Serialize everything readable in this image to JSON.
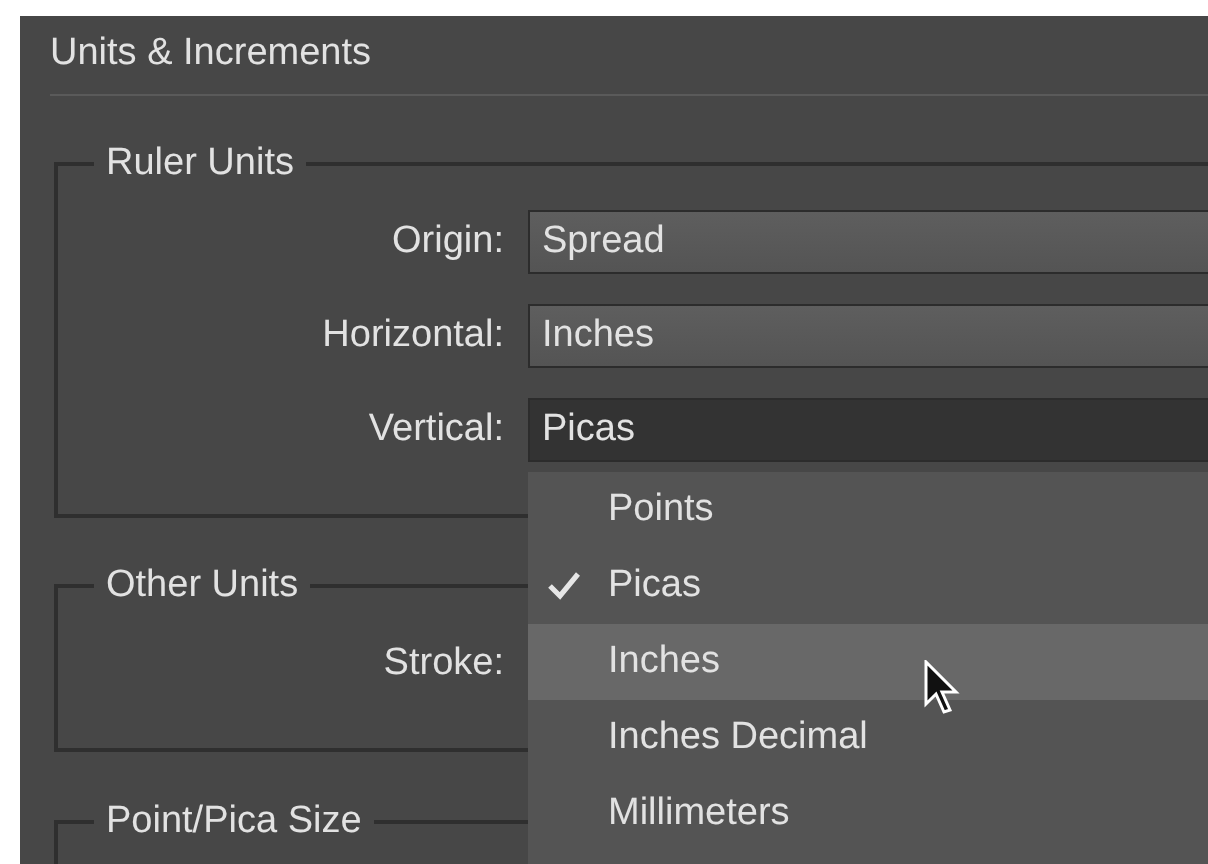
{
  "panel": {
    "title": "Units & Increments"
  },
  "groups": [
    {
      "legend": "Ruler Units",
      "fields": [
        {
          "label": "Origin:",
          "value": "Spread",
          "focused": false
        },
        {
          "label": "Horizontal:",
          "value": "Inches",
          "focused": false
        },
        {
          "label": "Vertical:",
          "value": "Picas",
          "focused": true
        }
      ]
    },
    {
      "legend": "Other Units",
      "fields": [
        {
          "label": "Stroke:"
        }
      ]
    },
    {
      "legend": "Point/Pica Size"
    }
  ],
  "menu": {
    "items": [
      {
        "label": "Points",
        "checked": false,
        "highlighted": false
      },
      {
        "label": "Picas",
        "checked": true,
        "highlighted": false
      },
      {
        "label": "Inches",
        "checked": false,
        "highlighted": true
      },
      {
        "label": "Inches Decimal",
        "checked": false,
        "highlighted": false
      },
      {
        "label": "Millimeters",
        "checked": false,
        "highlighted": false
      }
    ]
  }
}
